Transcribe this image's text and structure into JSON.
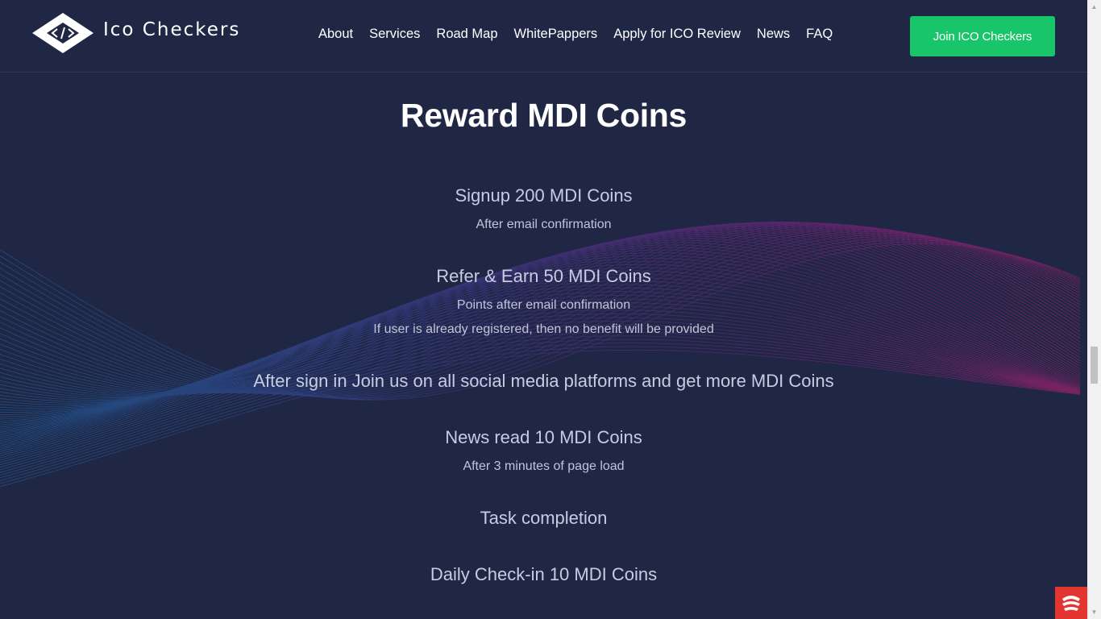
{
  "brand": {
    "name": "Ico Checkers",
    "logo_icon": "diamond-code-icon"
  },
  "nav": {
    "items": [
      {
        "label": "About"
      },
      {
        "label": "Services"
      },
      {
        "label": "Road Map"
      },
      {
        "label": "WhitePappers"
      },
      {
        "label": "Apply for ICO Review"
      },
      {
        "label": "News"
      },
      {
        "label": "FAQ"
      }
    ],
    "cta_label": "Join ICO Checkers"
  },
  "main": {
    "title": "Reward MDI Coins",
    "rewards": [
      {
        "title": "Signup 200 MDI Coins",
        "notes": [
          "After email confirmation"
        ]
      },
      {
        "title": "Refer & Earn 50 MDI Coins",
        "notes": [
          "Points after email confirmation",
          "If user is already registered, then no benefit will be provided"
        ]
      },
      {
        "title": "After sign in Join us on all social media platforms and get more MDI Coins",
        "notes": []
      },
      {
        "title": "News read 10 MDI Coins",
        "notes": [
          "After 3 minutes of page load"
        ]
      },
      {
        "title": "Task completion",
        "notes": []
      },
      {
        "title": "Daily Check-in 10 MDI Coins",
        "notes": []
      }
    ]
  },
  "colors": {
    "background": "#1f2744",
    "cta": "#18c56a",
    "wave_blue": "#1f6fb5",
    "wave_magenta": "#c2207a",
    "chat_widget": "#e3342f"
  },
  "widgets": {
    "chat_icon": "chat-icon"
  }
}
